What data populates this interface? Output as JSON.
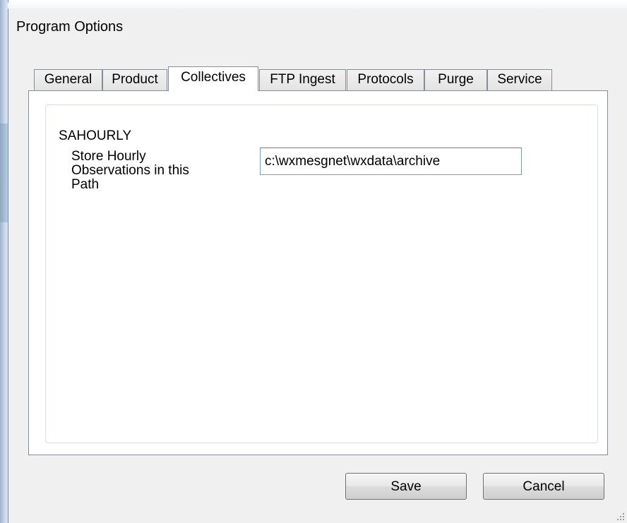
{
  "window": {
    "title": "Program Options"
  },
  "tabs": [
    {
      "label": "General",
      "active": false
    },
    {
      "label": "Product",
      "active": false
    },
    {
      "label": "Collectives",
      "active": true
    },
    {
      "label": "FTP Ingest",
      "active": false
    },
    {
      "label": "Protocols",
      "active": false
    },
    {
      "label": "Purge",
      "active": false
    },
    {
      "label": "Service",
      "active": false
    }
  ],
  "collectives": {
    "section_label": "SAHOURLY",
    "path_label": "Store Hourly\nObservations in this\nPath",
    "path_value": "c:\\wxmesgnet\\wxdata\\archive"
  },
  "buttons": {
    "save": "Save",
    "cancel": "Cancel"
  }
}
